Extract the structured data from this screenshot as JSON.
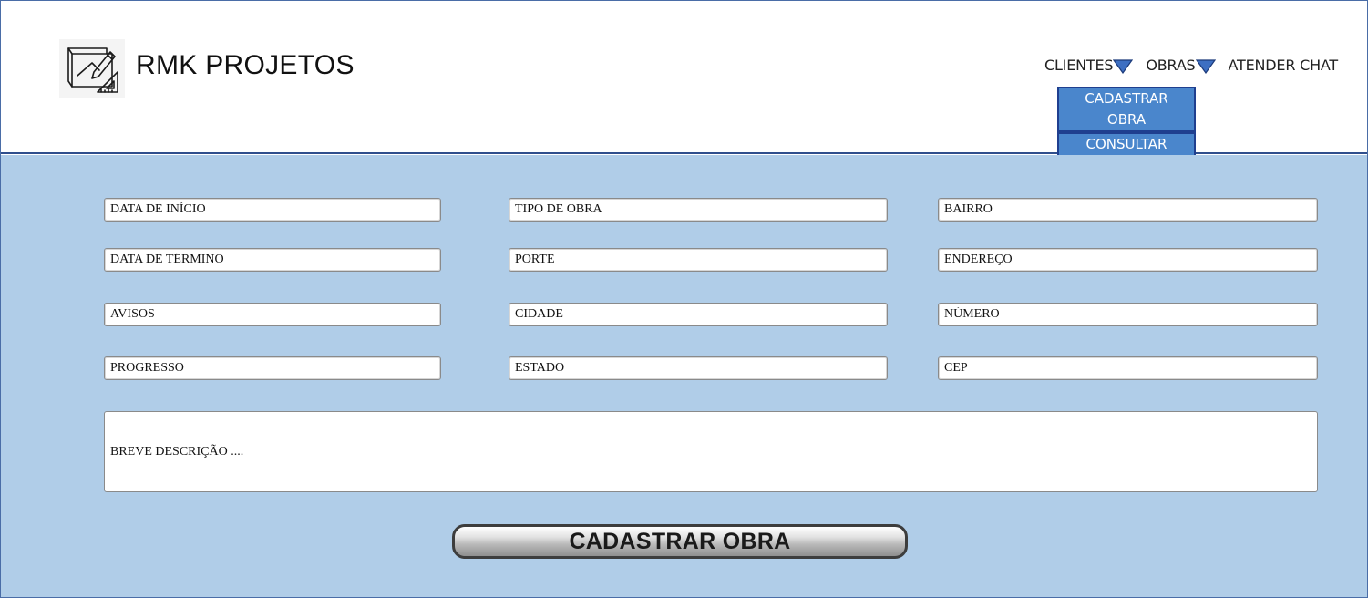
{
  "brand": {
    "name": "RMK PROJETOS",
    "logo_icon": "blueprint-drafting-icon"
  },
  "nav": {
    "items": [
      {
        "label": "CLIENTES",
        "has_dropdown": true
      },
      {
        "label": "OBRAS",
        "has_dropdown": true
      },
      {
        "label": "ATENDER CHAT",
        "has_dropdown": false
      }
    ],
    "caret_color": "#3d6fc2"
  },
  "dropdown": {
    "items": [
      {
        "label": "CADASTRAR OBRA"
      },
      {
        "label": "CONSULTAR OBRA"
      }
    ]
  },
  "form": {
    "fields": {
      "data_inicio": "DATA DE INÍCIO",
      "data_termino": "DATA DE TÉRMINO",
      "avisos": "AVISOS",
      "progresso": "PROGRESSO",
      "tipo_obra": "TIPO DE OBRA",
      "porte": "PORTE",
      "cidade": "CIDADE",
      "estado": "ESTADO",
      "bairro": "BAIRRO",
      "endereco": "ENDEREÇO",
      "numero": "NÚMERO",
      "cep": "CEP"
    },
    "descricao_placeholder": "BREVE DESCRIÇÃO ....",
    "submit_label": "CADASTRAR OBRA"
  },
  "colors": {
    "header_border": "#2f4e8c",
    "main_background": "#b0cde8",
    "dropdown_background": "#4a86cc",
    "dropdown_border": "#1f3f8f"
  }
}
